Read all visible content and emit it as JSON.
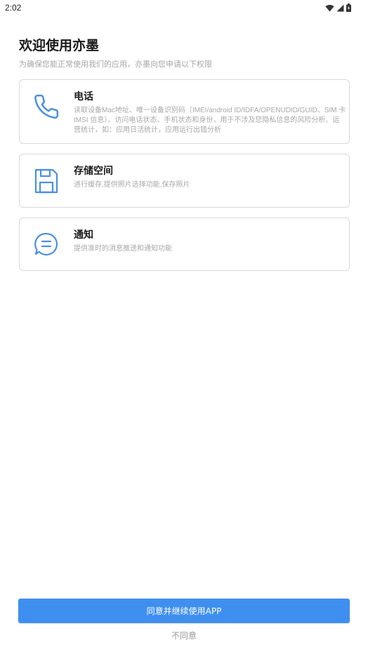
{
  "status_bar": {
    "time": "2:02",
    "icons": [
      "wifi-icon",
      "signal-icon",
      "battery-icon"
    ]
  },
  "header": {
    "title": "欢迎使用亦墨",
    "subtitle": "为确保您能正常使用我们的应用，亦墨向您申请以下权限"
  },
  "permissions": [
    {
      "icon": "phone-icon",
      "title": "电话",
      "description": "读取设备Mac地址、唯一设备识别码（IMEI/android ID/IDFA/OPENUDID/GUID、SIM 卡 IMSI 信息）、访问电话状态、手机状态和身份，用于不涉及您隐私信息的风险分析、运营统计，如：应用日活统计，应用运行出错分析"
    },
    {
      "icon": "save-disk-icon",
      "title": "存储空间",
      "description": "进行缓存,提供照片选择功能,保存照片"
    },
    {
      "icon": "message-icon",
      "title": "通知",
      "description": "提供准时的消息推送和通知功能"
    }
  ],
  "actions": {
    "agree_label": "同意并继续使用APP",
    "decline_label": "不同意"
  },
  "colors": {
    "accent": "#3f8ff0",
    "icon": "#4a90e2",
    "border": "#d9d9d9",
    "muted_text": "#a8a8a8"
  }
}
